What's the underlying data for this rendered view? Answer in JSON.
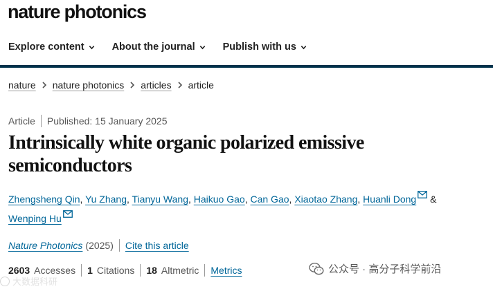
{
  "header": {
    "logo": "nature photonics",
    "nav": [
      {
        "label": "Explore content"
      },
      {
        "label": "About the journal"
      },
      {
        "label": "Publish with us"
      }
    ]
  },
  "breadcrumb": {
    "items": [
      "nature",
      "nature photonics",
      "articles"
    ],
    "current": "article"
  },
  "article": {
    "type": "Article",
    "published": "Published: 15 January 2025",
    "title": "Intrinsically white organic polarized emissive semiconductors",
    "authors": [
      "Zhengsheng Qin",
      "Yu Zhang",
      "Tianyu Wang",
      "Haikuo Gao",
      "Can Gao",
      "Xiaotao Zhang",
      "Huanli Dong",
      "Wenping Hu"
    ],
    "author_separator": ", ",
    "author_amp": " & ",
    "journal": "Nature Photonics",
    "year": "(2025)",
    "cite_label": "Cite this article"
  },
  "metrics": {
    "accesses_count": "2603",
    "accesses_label": "Accesses",
    "citations_count": "1",
    "citations_label": "Citations",
    "altmetric_count": "18",
    "altmetric_label": "Altmetric",
    "metrics_link": "Metrics"
  },
  "watermark": {
    "wechat_text": "公众号 · 高分子科学前沿",
    "bottom_text": "大数据科研"
  },
  "colors": {
    "nav_bar": "#01324b",
    "link": "#006699"
  }
}
